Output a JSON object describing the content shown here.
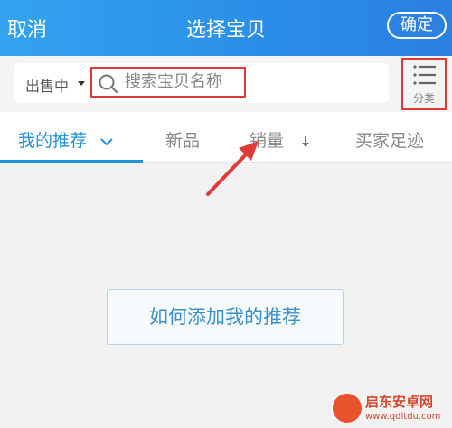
{
  "header": {
    "cancel_label": "取消",
    "title": "选择宝贝",
    "confirm_label": "确定"
  },
  "search": {
    "status_label": "出售中",
    "placeholder": "搜索宝贝名称",
    "category_label": "分类",
    "category_icon": "list-icon",
    "search_icon": "magnifier-icon"
  },
  "tabs": [
    {
      "label": "我的推荐",
      "active": true
    },
    {
      "label": "新品",
      "active": false
    },
    {
      "label": "销量",
      "active": false
    },
    {
      "label": "买家足迹",
      "active": false
    }
  ],
  "main": {
    "empty_button_label": "如何添加我的推荐"
  },
  "watermark": {
    "text": "启东安卓网",
    "url": "www.qdltdu.com"
  },
  "colors": {
    "accent": "#1f92d8",
    "header_blue": "#2a8fe8",
    "highlight_red": "#e23a3a"
  }
}
